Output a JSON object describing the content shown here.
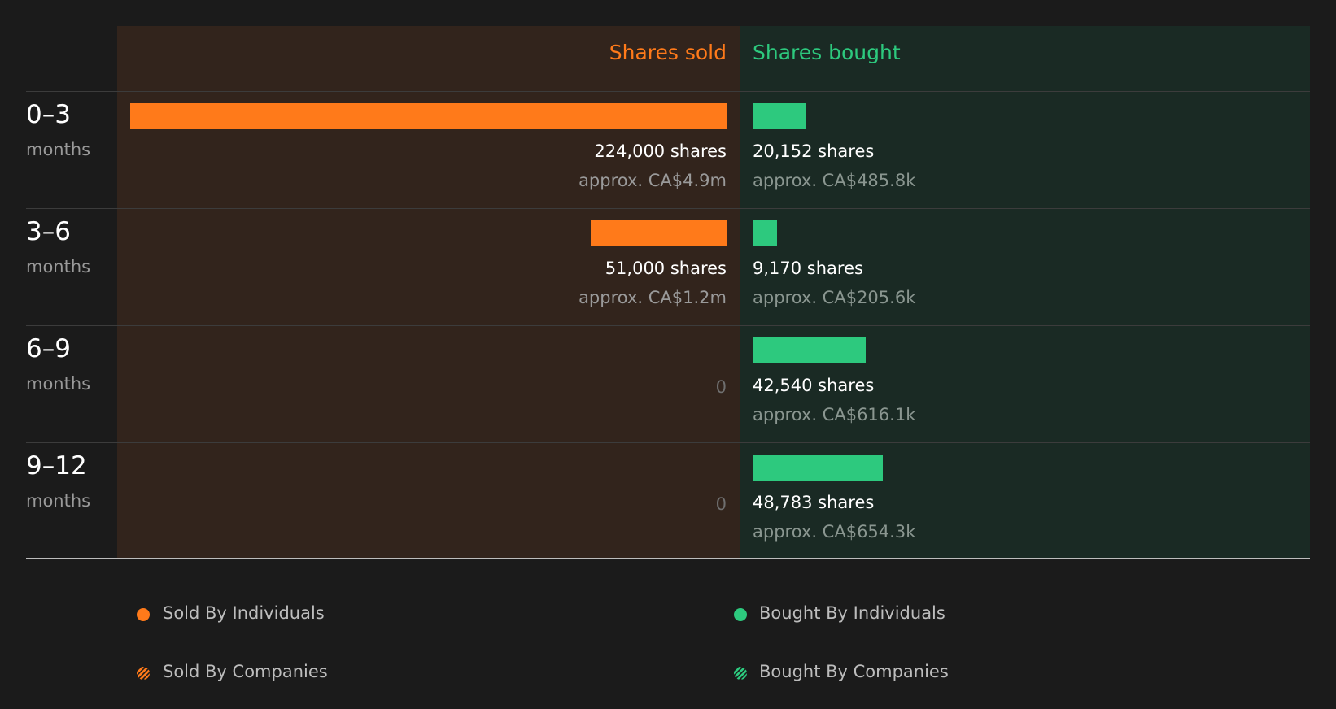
{
  "colors": {
    "sold": "#ff7a1a",
    "bought": "#2dc97e",
    "sold_panel": "#32241c",
    "bought_panel": "#1a2a24",
    "background": "#1b1b1b"
  },
  "chart_data": {
    "type": "bar",
    "orientation": "horizontal diverging",
    "columns": {
      "sold": "Shares sold",
      "bought": "Shares bought"
    },
    "categories": [
      {
        "label": "0–3",
        "unit": "months"
      },
      {
        "label": "3–6",
        "unit": "months"
      },
      {
        "label": "6–9",
        "unit": "months"
      },
      {
        "label": "9–12",
        "unit": "months"
      }
    ],
    "series": [
      {
        "name": "Shares sold",
        "values": [
          224000,
          51000,
          0,
          0
        ],
        "value_labels": [
          "224,000 shares",
          "51,000 shares",
          "0",
          "0"
        ],
        "approx_labels": [
          "approx. CA$4.9m",
          "approx. CA$1.2m",
          "",
          ""
        ]
      },
      {
        "name": "Shares bought",
        "values": [
          20152,
          9170,
          42540,
          48783
        ],
        "value_labels": [
          "20,152 shares",
          "9,170 shares",
          "42,540 shares",
          "48,783 shares"
        ],
        "approx_labels": [
          "approx. CA$485.8k",
          "approx. CA$205.6k",
          "approx. CA$616.1k",
          "approx. CA$654.3k"
        ]
      }
    ],
    "legend": {
      "placement": "bottom",
      "items": [
        {
          "label": "Sold By Individuals",
          "style": "solid-dot",
          "color": "#ff7a1a"
        },
        {
          "label": "Bought By Individuals",
          "style": "solid-dot",
          "color": "#2dc97e"
        },
        {
          "label": "Sold By Companies",
          "style": "hatched-dot",
          "color": "#ff7a1a"
        },
        {
          "label": "Bought By Companies",
          "style": "hatched-dot",
          "color": "#2dc97e"
        }
      ]
    },
    "grid": false
  }
}
